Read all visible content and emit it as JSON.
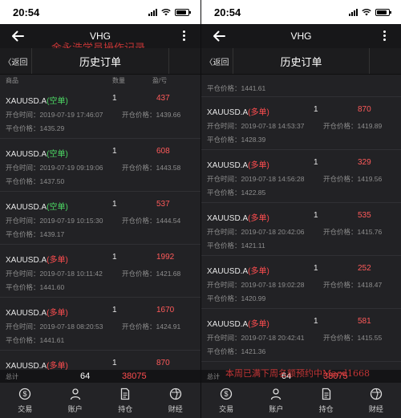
{
  "status": {
    "time": "20:54"
  },
  "nav": {
    "title": "VHG"
  },
  "subbar": {
    "back_label": "〈返回",
    "title": "历史订单"
  },
  "columns": {
    "product": "商品",
    "quantity": "数量",
    "profit": "盈/亏"
  },
  "labels": {
    "open_time": "开仓时间：",
    "open_price": "开仓价格：",
    "close_price": "平仓价格：",
    "total": "总计"
  },
  "totals": {
    "quantity": "64",
    "profit": "38075"
  },
  "tabs": [
    {
      "label": "交易",
      "icon": "dollar-coin-icon"
    },
    {
      "label": "账户",
      "icon": "person-icon"
    },
    {
      "label": "持仓",
      "icon": "document-icon"
    },
    {
      "label": "财经",
      "icon": "finance-globe-icon"
    }
  ],
  "watermarks": {
    "left": "金永浩学员操作记录",
    "right": "本周已满下周名额预约中Macd1668"
  },
  "left_orders": [
    {
      "symbol": "XAUUSD.A",
      "direction": "(空单)",
      "dir_type": "short",
      "qty": "1",
      "profit": "437",
      "open_time": "2019-07-19 17:46:07",
      "open_price": "1439.66",
      "close_price": "1435.29"
    },
    {
      "symbol": "XAUUSD.A",
      "direction": "(空单)",
      "dir_type": "short",
      "qty": "1",
      "profit": "608",
      "open_time": "2019-07-19 09:19:06",
      "open_price": "1443.58",
      "close_price": "1437.50"
    },
    {
      "symbol": "XAUUSD.A",
      "direction": "(空单)",
      "dir_type": "short",
      "qty": "1",
      "profit": "537",
      "open_time": "2019-07-19 10:15:30",
      "open_price": "1444.54",
      "close_price": "1439.17"
    },
    {
      "symbol": "XAUUSD.A",
      "direction": "(多单)",
      "dir_type": "long",
      "qty": "1",
      "profit": "1992",
      "open_time": "2019-07-18 10:11:42",
      "open_price": "1421.68",
      "close_price": "1441.60"
    },
    {
      "symbol": "XAUUSD.A",
      "direction": "(多单)",
      "dir_type": "long",
      "qty": "1",
      "profit": "1670",
      "open_time": "2019-07-18 08:20:53",
      "open_price": "1424.91",
      "close_price": "1441.61"
    },
    {
      "symbol": "XAUUSD.A",
      "direction": "(多单)",
      "dir_type": "long",
      "qty": "1",
      "profit": "870",
      "open_time": "",
      "open_price": "",
      "close_price": ""
    }
  ],
  "right_partial": {
    "close_price": "1441.61"
  },
  "right_orders": [
    {
      "symbol": "XAUUSD.A",
      "direction": "(多单)",
      "dir_type": "long",
      "qty": "1",
      "profit": "870",
      "open_time": "2019-07-18 14:53:37",
      "open_price": "1419.89",
      "close_price": "1428.39"
    },
    {
      "symbol": "XAUUSD.A",
      "direction": "(多单)",
      "dir_type": "long",
      "qty": "1",
      "profit": "329",
      "open_time": "2019-07-18 14:56:28",
      "open_price": "1419.56",
      "close_price": "1422.85"
    },
    {
      "symbol": "XAUUSD.A",
      "direction": "(多单)",
      "dir_type": "long",
      "qty": "1",
      "profit": "535",
      "open_time": "2019-07-18 20:42:06",
      "open_price": "1415.76",
      "close_price": "1421.11"
    },
    {
      "symbol": "XAUUSD.A",
      "direction": "(多单)",
      "dir_type": "long",
      "qty": "1",
      "profit": "252",
      "open_time": "2019-07-18 19:02:28",
      "open_price": "1418.47",
      "close_price": "1420.99"
    },
    {
      "symbol": "XAUUSD.A",
      "direction": "(多单)",
      "dir_type": "long",
      "qty": "1",
      "profit": "581",
      "open_time": "2019-07-18 20:42:41",
      "open_price": "1415.55",
      "close_price": "1421.36"
    }
  ],
  "colors": {
    "short": "#4cd964",
    "long": "#ff4d4f",
    "profit": "#ff5a5a",
    "background": "#222225"
  }
}
